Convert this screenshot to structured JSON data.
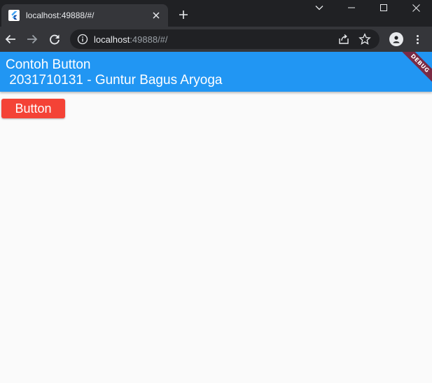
{
  "browser": {
    "tab": {
      "title": "localhost:49888/#/"
    },
    "address_bar": {
      "host": "localhost",
      "rest": ":49888/#/"
    },
    "colors": {
      "frame": "#202124",
      "toolbar": "#35363a",
      "text": "#e8eaed"
    }
  },
  "app": {
    "appbar": {
      "title_line1": "Contoh Button",
      "title_line2": " 2031710131 - Guntur Bagus Aryoga",
      "color": "#2196f3"
    },
    "debug_banner": "DEBUG",
    "button": {
      "label": "Button",
      "color": "#f44336"
    },
    "background": "#fafafa"
  }
}
